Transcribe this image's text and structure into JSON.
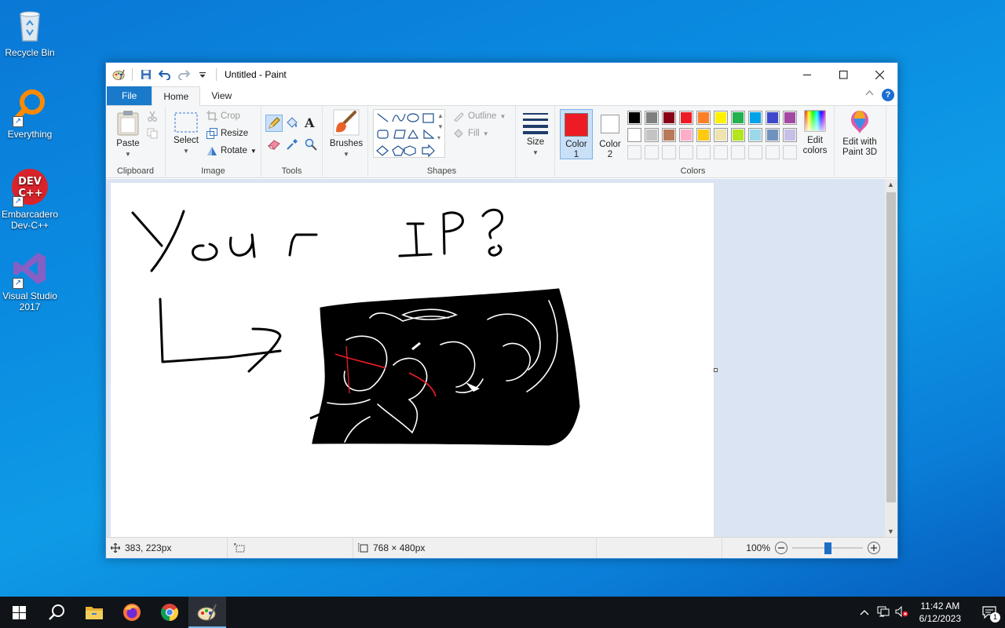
{
  "desktop": {
    "icons": [
      {
        "label": "Recycle Bin"
      },
      {
        "label": "Everything"
      },
      {
        "label": "Embarcadero Dev-C++"
      },
      {
        "label": "Visual Studio 2017"
      }
    ]
  },
  "window": {
    "title": "Untitled - Paint",
    "tabs": {
      "file": "File",
      "home": "Home",
      "view": "View"
    },
    "clipboard": {
      "paste": "Paste",
      "label": "Clipboard"
    },
    "image": {
      "select": "Select",
      "crop": "Crop",
      "resize": "Resize",
      "rotate": "Rotate",
      "label": "Image"
    },
    "tools": {
      "label": "Tools",
      "text_glyph": "A"
    },
    "brushes": {
      "label": "Brushes"
    },
    "shapes": {
      "outline": "Outline",
      "fill": "Fill",
      "label": "Shapes"
    },
    "size": {
      "label": "Size"
    },
    "colors": {
      "color1_line1": "Color",
      "color1_line2": "1",
      "color2_line1": "Color",
      "color2_line2": "2",
      "edit_line1": "Edit",
      "edit_line2": "colors",
      "label": "Colors",
      "color1": "#ed1c24",
      "color2": "#ffffff",
      "row1": [
        "#000000",
        "#7f7f7f",
        "#880015",
        "#ed1c24",
        "#ff7f27",
        "#fff200",
        "#22b14c",
        "#00a2e8",
        "#3f48cc",
        "#a349a4"
      ],
      "row2": [
        "#ffffff",
        "#c3c3c3",
        "#b97a57",
        "#ffaec9",
        "#ffc90e",
        "#efe4b0",
        "#b5e61d",
        "#99d9ea",
        "#7092be",
        "#c8bfe7"
      ],
      "row3": [
        "",
        "",
        "",
        "",
        "",
        "",
        "",
        "",
        "",
        ""
      ]
    },
    "paint3d": {
      "line1": "Edit with",
      "line2": "Paint 3D"
    },
    "statusbar": {
      "cursor_pos": "383, 223px",
      "image_size": "768 × 480px",
      "zoom": "100%",
      "zoom_fraction": 0.5
    }
  },
  "taskbar": {
    "time": "11:42 AM",
    "date": "6/12/2023",
    "notifications": "1"
  }
}
